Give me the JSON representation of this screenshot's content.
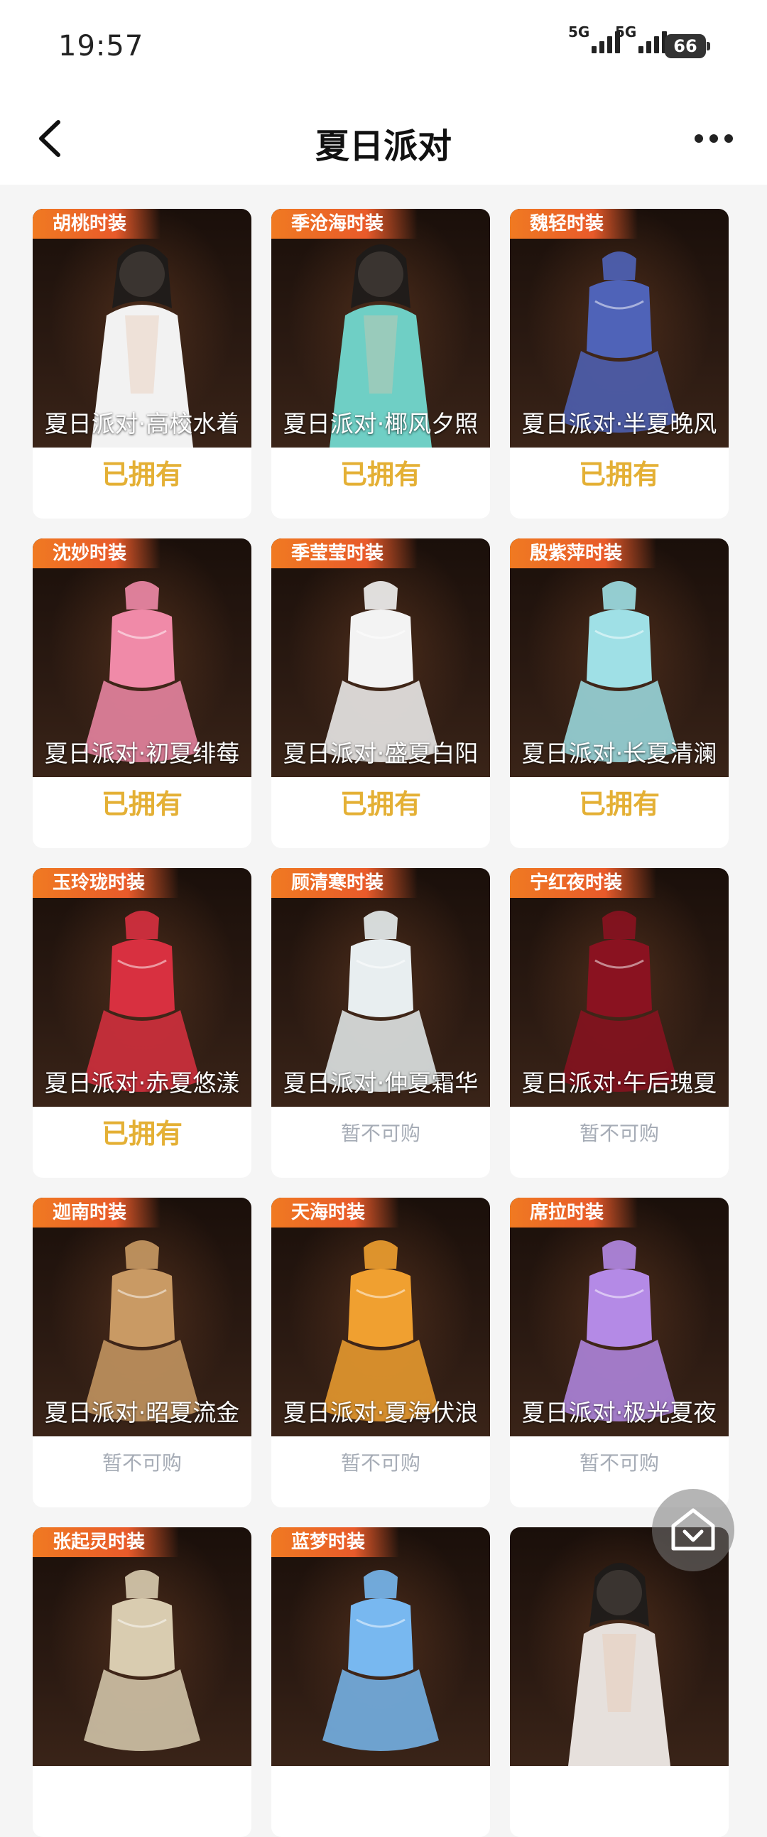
{
  "status_bar": {
    "time": "19:57",
    "signal1": "5G",
    "signal2": "5G",
    "battery": "66"
  },
  "header": {
    "title": "夏日派对"
  },
  "cards": [
    {
      "tag": "胡桃时装",
      "name": "夏日派对·高校水着",
      "status": "已拥有",
      "owned": true,
      "color": "#f2f2f2",
      "kind": "figure"
    },
    {
      "tag": "季沧海时装",
      "name": "夏日派对·椰风夕照",
      "status": "已拥有",
      "owned": true,
      "color": "#6fcfc5",
      "kind": "figure"
    },
    {
      "tag": "魏轻时装",
      "name": "夏日派对·半夏晚风",
      "status": "已拥有",
      "owned": true,
      "color": "#4f63b8",
      "kind": "outfit"
    },
    {
      "tag": "沈妙时装",
      "name": "夏日派对·初夏绯莓",
      "status": "已拥有",
      "owned": true,
      "color": "#f08aa8",
      "kind": "outfit"
    },
    {
      "tag": "季莹莹时装",
      "name": "夏日派对·盛夏白阳",
      "status": "已拥有",
      "owned": true,
      "color": "#f3f3f3",
      "kind": "outfit"
    },
    {
      "tag": "殷紫萍时装",
      "name": "夏日派对·长夏清澜",
      "status": "已拥有",
      "owned": true,
      "color": "#9fe0e6",
      "kind": "outfit"
    },
    {
      "tag": "玉玲珑时装",
      "name": "夏日派对·赤夏悠漾",
      "status": "已拥有",
      "owned": true,
      "color": "#d83040",
      "kind": "outfit"
    },
    {
      "tag": "顾清寒时装",
      "name": "夏日派对·仲夏霜华",
      "status": "暂不可购",
      "owned": false,
      "color": "#e8eef0",
      "kind": "outfit"
    },
    {
      "tag": "宁红夜时装",
      "name": "夏日派对·午后瑰夏",
      "status": "暂不可购",
      "owned": false,
      "color": "#8a1220",
      "kind": "outfit"
    },
    {
      "tag": "迦南时装",
      "name": "夏日派对·昭夏流金",
      "status": "暂不可购",
      "owned": false,
      "color": "#c99a64",
      "kind": "outfit"
    },
    {
      "tag": "天海时装",
      "name": "夏日派对·夏海伏浪",
      "status": "暂不可购",
      "owned": false,
      "color": "#f0a030",
      "kind": "outfit"
    },
    {
      "tag": "席拉时装",
      "name": "夏日派对·极光夏夜",
      "status": "暂不可购",
      "owned": false,
      "color": "#b48ae6",
      "kind": "outfit"
    },
    {
      "tag": "张起灵时装",
      "name": "",
      "status": "",
      "owned": false,
      "color": "#d9ccb0",
      "kind": "outfit"
    },
    {
      "tag": "蓝梦时装",
      "name": "",
      "status": "",
      "owned": false,
      "color": "#78b8f0",
      "kind": "outfit"
    },
    {
      "tag": "",
      "name": "",
      "status": "",
      "owned": false,
      "color": "#e6e0dc",
      "kind": "figure"
    }
  ],
  "icons": {
    "back": "chevron-left-icon",
    "more": "more-dots-icon",
    "fab": "collapse-down-icon"
  }
}
